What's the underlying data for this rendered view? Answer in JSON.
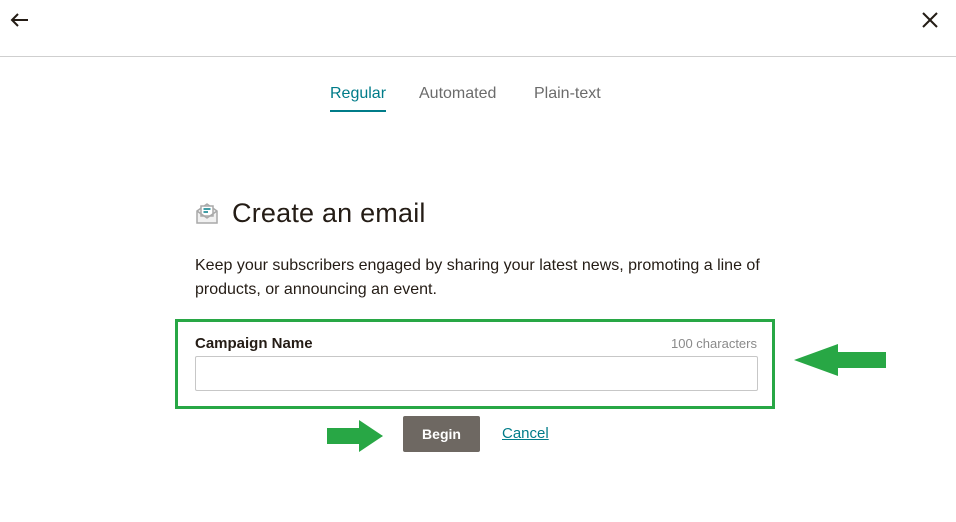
{
  "header": {
    "back_icon": "arrow-left-icon",
    "close_icon": "close-icon"
  },
  "tabs": [
    {
      "label": "Regular",
      "active": true
    },
    {
      "label": "Automated",
      "active": false
    },
    {
      "label": "Plain-text",
      "active": false
    }
  ],
  "main": {
    "icon": "email-icon",
    "title": "Create an email",
    "description": "Keep your subscribers engaged by sharing your latest news, promoting a line of products, or announcing an event."
  },
  "form": {
    "campaign_label": "Campaign Name",
    "char_limit": "100 characters",
    "campaign_value": "",
    "begin_label": "Begin",
    "cancel_label": "Cancel"
  },
  "colors": {
    "accent": "#007c89",
    "button_bg": "#6e6862",
    "annotation_green": "#28a745",
    "text": "#241c15"
  }
}
